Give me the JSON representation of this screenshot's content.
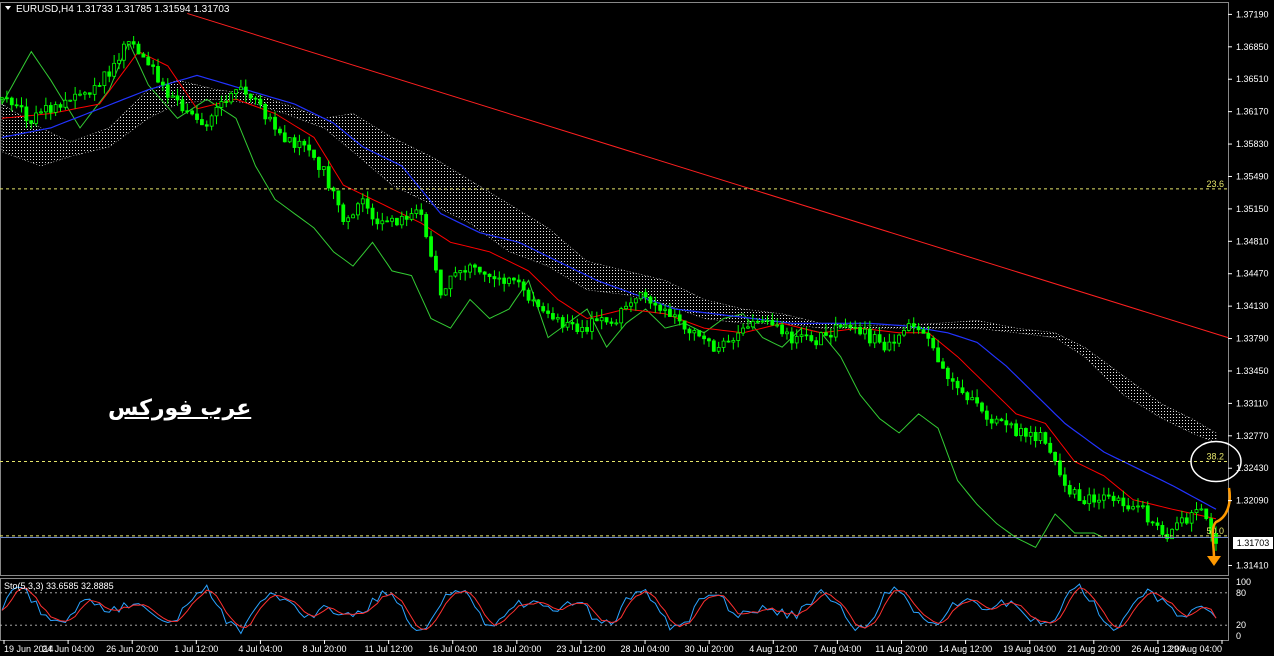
{
  "header": {
    "symbol_text": "EURUSD,H4 1.31733 1.31785 1.31594 1.31703",
    "menu_icon": "triangle-down-icon"
  },
  "watermark": "عرب فوركس",
  "current_price_label": "1.31703",
  "colors": {
    "background": "#000000",
    "candle": "#00ff00",
    "chikou": "#33cc33",
    "tenkan": "#ff0000",
    "kijun": "#2233ff",
    "cloud": "#ffffff",
    "trendline": "#ff2020",
    "fib": "#e6e66a",
    "price_line": "#6c86c8",
    "arrow": "#ff9900",
    "stoch_main": "#2aa3ff",
    "stoch_signal": "#ff3030"
  },
  "chart_data": {
    "type": "candlestick",
    "symbol": "EURUSD",
    "timeframe": "H4",
    "ohlc_current": {
      "open": 1.31733,
      "high": 1.31785,
      "low": 1.31594,
      "close": 1.31703
    },
    "y_ticks": [
      "1.37190",
      "1.36850",
      "1.36510",
      "1.36170",
      "1.35830",
      "1.35490",
      "1.35150",
      "1.34810",
      "1.34470",
      "1.34130",
      "1.33790",
      "1.33450",
      "1.33110",
      "1.32770",
      "1.32430",
      "1.32090",
      "1.31410"
    ],
    "ylim": [
      1.3131,
      1.3732
    ],
    "x_ticks": [
      "19 Jun 2014",
      "24 Jun 04:00",
      "26 Jun 20:00",
      "1 Jul 12:00",
      "4 Jul 04:00",
      "8 Jul 20:00",
      "11 Jul 12:00",
      "16 Jul 04:00",
      "18 Jul 20:00",
      "23 Jul 12:00",
      "28 Jul 04:00",
      "30 Jul 20:00",
      "4 Aug 12:00",
      "7 Aug 04:00",
      "11 Aug 20:00",
      "14 Aug 12:00",
      "19 Aug 04:00",
      "21 Aug 20:00",
      "26 Aug 12:00",
      "29 Aug 04:00"
    ],
    "close_path": [
      [
        0,
        1.363
      ],
      [
        6,
        1.361
      ],
      [
        12,
        1.3625
      ],
      [
        18,
        1.3635
      ],
      [
        22,
        1.366
      ],
      [
        26,
        1.369
      ],
      [
        29,
        1.368
      ],
      [
        33,
        1.364
      ],
      [
        37,
        1.362
      ],
      [
        41,
        1.36
      ],
      [
        45,
        1.3625
      ],
      [
        49,
        1.364
      ],
      [
        53,
        1.362
      ],
      [
        58,
        1.359
      ],
      [
        62,
        1.358
      ],
      [
        66,
        1.3555
      ],
      [
        70,
        1.3505
      ],
      [
        74,
        1.352
      ],
      [
        78,
        1.35
      ],
      [
        82,
        1.3505
      ],
      [
        86,
        1.351
      ],
      [
        90,
        1.343
      ],
      [
        94,
        1.3455
      ],
      [
        98,
        1.345
      ],
      [
        102,
        1.344
      ],
      [
        106,
        1.344
      ],
      [
        110,
        1.341
      ],
      [
        114,
        1.34
      ],
      [
        118,
        1.3385
      ],
      [
        122,
        1.34
      ],
      [
        126,
        1.34
      ],
      [
        130,
        1.3425
      ],
      [
        134,
        1.3415
      ],
      [
        138,
        1.34
      ],
      [
        142,
        1.3385
      ],
      [
        146,
        1.337
      ],
      [
        150,
        1.3375
      ],
      [
        154,
        1.34
      ],
      [
        158,
        1.3395
      ],
      [
        162,
        1.338
      ],
      [
        166,
        1.3375
      ],
      [
        170,
        1.3385
      ],
      [
        174,
        1.3395
      ],
      [
        178,
        1.338
      ],
      [
        182,
        1.337
      ],
      [
        186,
        1.3395
      ],
      [
        190,
        1.338
      ],
      [
        194,
        1.334
      ],
      [
        198,
        1.332
      ],
      [
        202,
        1.33
      ],
      [
        206,
        1.3285
      ],
      [
        210,
        1.328
      ],
      [
        214,
        1.3275
      ],
      [
        218,
        1.3225
      ],
      [
        222,
        1.321
      ],
      [
        226,
        1.3215
      ],
      [
        230,
        1.3205
      ],
      [
        234,
        1.32
      ],
      [
        238,
        1.317
      ],
      [
        242,
        1.3185
      ],
      [
        246,
        1.32
      ],
      [
        249,
        1.317
      ]
    ],
    "tenkan_path": [
      [
        0,
        1.361
      ],
      [
        10,
        1.3615
      ],
      [
        20,
        1.3625
      ],
      [
        28,
        1.368
      ],
      [
        34,
        1.3665
      ],
      [
        40,
        1.362
      ],
      [
        48,
        1.363
      ],
      [
        56,
        1.3615
      ],
      [
        64,
        1.359
      ],
      [
        70,
        1.354
      ],
      [
        78,
        1.352
      ],
      [
        86,
        1.35
      ],
      [
        92,
        1.348
      ],
      [
        100,
        1.347
      ],
      [
        108,
        1.345
      ],
      [
        114,
        1.342
      ],
      [
        120,
        1.34
      ],
      [
        128,
        1.341
      ],
      [
        136,
        1.3405
      ],
      [
        144,
        1.339
      ],
      [
        152,
        1.3385
      ],
      [
        160,
        1.3395
      ],
      [
        168,
        1.3385
      ],
      [
        176,
        1.339
      ],
      [
        184,
        1.3385
      ],
      [
        190,
        1.3385
      ],
      [
        196,
        1.336
      ],
      [
        202,
        1.333
      ],
      [
        208,
        1.33
      ],
      [
        214,
        1.329
      ],
      [
        220,
        1.325
      ],
      [
        226,
        1.3235
      ],
      [
        232,
        1.321
      ],
      [
        240,
        1.32
      ],
      [
        249,
        1.319
      ]
    ],
    "kijun_path": [
      [
        0,
        1.359
      ],
      [
        10,
        1.36
      ],
      [
        20,
        1.362
      ],
      [
        30,
        1.364
      ],
      [
        40,
        1.3655
      ],
      [
        50,
        1.364
      ],
      [
        60,
        1.3625
      ],
      [
        68,
        1.3605
      ],
      [
        74,
        1.358
      ],
      [
        82,
        1.356
      ],
      [
        90,
        1.351
      ],
      [
        98,
        1.349
      ],
      [
        106,
        1.348
      ],
      [
        114,
        1.346
      ],
      [
        122,
        1.344
      ],
      [
        130,
        1.3425
      ],
      [
        138,
        1.341
      ],
      [
        146,
        1.3405
      ],
      [
        154,
        1.34
      ],
      [
        162,
        1.3395
      ],
      [
        170,
        1.3395
      ],
      [
        178,
        1.3395
      ],
      [
        186,
        1.3392
      ],
      [
        194,
        1.3385
      ],
      [
        200,
        1.3375
      ],
      [
        206,
        1.335
      ],
      [
        212,
        1.332
      ],
      [
        218,
        1.329
      ],
      [
        226,
        1.326
      ],
      [
        234,
        1.324
      ],
      [
        240,
        1.3225
      ],
      [
        249,
        1.32
      ]
    ],
    "cloud_upper_path": [
      [
        0,
        1.3625
      ],
      [
        8,
        1.36
      ],
      [
        14,
        1.3585
      ],
      [
        22,
        1.36
      ],
      [
        30,
        1.364
      ],
      [
        36,
        1.365
      ],
      [
        44,
        1.364
      ],
      [
        52,
        1.3635
      ],
      [
        58,
        1.3625
      ],
      [
        66,
        1.361
      ],
      [
        72,
        1.3615
      ],
      [
        80,
        1.359
      ],
      [
        88,
        1.357
      ],
      [
        96,
        1.3545
      ],
      [
        104,
        1.352
      ],
      [
        112,
        1.3495
      ],
      [
        120,
        1.346
      ],
      [
        128,
        1.345
      ],
      [
        136,
        1.344
      ],
      [
        144,
        1.342
      ],
      [
        152,
        1.341
      ],
      [
        160,
        1.3405
      ],
      [
        168,
        1.3395
      ],
      [
        176,
        1.3393
      ],
      [
        184,
        1.3393
      ],
      [
        192,
        1.3395
      ],
      [
        200,
        1.3398
      ],
      [
        208,
        1.339
      ],
      [
        216,
        1.3385
      ],
      [
        222,
        1.337
      ],
      [
        230,
        1.334
      ],
      [
        238,
        1.331
      ],
      [
        244,
        1.3295
      ],
      [
        249,
        1.328
      ]
    ],
    "cloud_lower_path": [
      [
        0,
        1.3575
      ],
      [
        8,
        1.356
      ],
      [
        14,
        1.357
      ],
      [
        22,
        1.358
      ],
      [
        30,
        1.361
      ],
      [
        36,
        1.3625
      ],
      [
        44,
        1.363
      ],
      [
        52,
        1.3625
      ],
      [
        58,
        1.3615
      ],
      [
        66,
        1.36
      ],
      [
        72,
        1.3575
      ],
      [
        80,
        1.354
      ],
      [
        88,
        1.352
      ],
      [
        96,
        1.35
      ],
      [
        104,
        1.347
      ],
      [
        112,
        1.3455
      ],
      [
        120,
        1.343
      ],
      [
        128,
        1.3425
      ],
      [
        136,
        1.3415
      ],
      [
        144,
        1.34
      ],
      [
        152,
        1.3395
      ],
      [
        160,
        1.3395
      ],
      [
        168,
        1.339
      ],
      [
        176,
        1.339
      ],
      [
        184,
        1.339
      ],
      [
        192,
        1.339
      ],
      [
        200,
        1.339
      ],
      [
        208,
        1.3385
      ],
      [
        216,
        1.338
      ],
      [
        222,
        1.336
      ],
      [
        230,
        1.332
      ],
      [
        238,
        1.3295
      ],
      [
        244,
        1.328
      ],
      [
        249,
        1.327
      ]
    ],
    "chikou_path": [
      [
        0,
        1.3625
      ],
      [
        6,
        1.368
      ],
      [
        10,
        1.365
      ],
      [
        16,
        1.36
      ],
      [
        22,
        1.364
      ],
      [
        26,
        1.369
      ],
      [
        30,
        1.3645
      ],
      [
        36,
        1.361
      ],
      [
        42,
        1.363
      ],
      [
        48,
        1.361
      ],
      [
        52,
        1.356
      ],
      [
        56,
        1.3525
      ],
      [
        60,
        1.351
      ],
      [
        64,
        1.3495
      ],
      [
        68,
        1.347
      ],
      [
        72,
        1.3455
      ],
      [
        76,
        1.348
      ],
      [
        80,
        1.345
      ],
      [
        84,
        1.3445
      ],
      [
        88,
        1.34
      ],
      [
        92,
        1.339
      ],
      [
        96,
        1.342
      ],
      [
        100,
        1.34
      ],
      [
        104,
        1.341
      ],
      [
        108,
        1.344
      ],
      [
        112,
        1.338
      ],
      [
        116,
        1.3395
      ],
      [
        120,
        1.341
      ],
      [
        124,
        1.337
      ],
      [
        128,
        1.3395
      ],
      [
        132,
        1.341
      ],
      [
        136,
        1.339
      ],
      [
        140,
        1.3395
      ],
      [
        144,
        1.3385
      ],
      [
        148,
        1.34
      ],
      [
        152,
        1.3405
      ],
      [
        156,
        1.338
      ],
      [
        160,
        1.337
      ],
      [
        164,
        1.339
      ],
      [
        168,
        1.3385
      ],
      [
        172,
        1.336
      ],
      [
        176,
        1.332
      ],
      [
        180,
        1.3295
      ],
      [
        184,
        1.328
      ],
      [
        188,
        1.33
      ],
      [
        192,
        1.3285
      ],
      [
        196,
        1.323
      ],
      [
        200,
        1.3205
      ],
      [
        204,
        1.3185
      ],
      [
        208,
        1.317
      ],
      [
        212,
        1.316
      ],
      [
        216,
        1.3195
      ],
      [
        220,
        1.3175
      ],
      [
        224,
        1.3175
      ],
      [
        226,
        1.317
      ]
    ],
    "trendline": {
      "from": [
        38,
        1.372
      ],
      "to": [
        249,
        1.338
      ]
    },
    "fib_levels": [
      {
        "label": "23.6",
        "value": 1.3536
      },
      {
        "label": "38.2",
        "value": 1.325
      },
      {
        "label": "50.0",
        "value": 1.3172
      }
    ],
    "price_line": 1.31703,
    "stochastic": {
      "label": "Sto(5,3,3) 33.6585 32.8885",
      "main": 33.6585,
      "signal": 32.8885,
      "levels": [
        "100",
        "80",
        "20",
        "0"
      ],
      "level_lines": [
        80,
        20
      ]
    }
  }
}
